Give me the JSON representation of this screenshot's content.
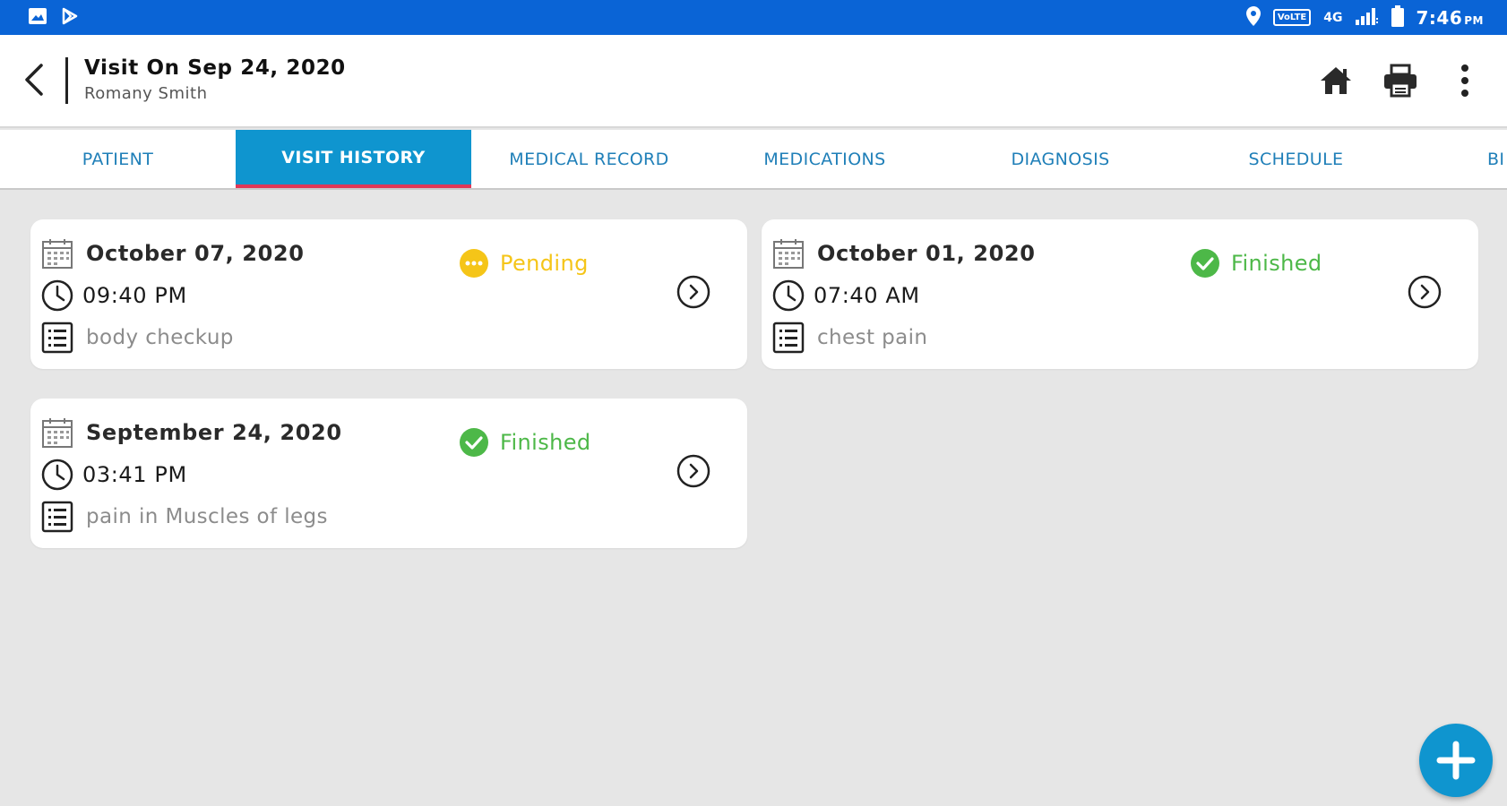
{
  "status_bar": {
    "time": "7:46",
    "time_suffix": "PM",
    "volte": "VoLTE",
    "network": "4G",
    "icons": [
      "image-icon",
      "play-store-icon",
      "location-icon",
      "signal-icon",
      "battery-icon"
    ]
  },
  "app_bar": {
    "title": "Visit On Sep 24, 2020",
    "subtitle": "Romany Smith",
    "actions": [
      "home-icon",
      "print-icon",
      "more-vert-icon"
    ]
  },
  "tabs": [
    {
      "label": "PATIENT",
      "active": false
    },
    {
      "label": "VISIT HISTORY",
      "active": true
    },
    {
      "label": "MEDICAL RECORD",
      "active": false
    },
    {
      "label": "MEDICATIONS",
      "active": false
    },
    {
      "label": "DIAGNOSIS",
      "active": false
    },
    {
      "label": "SCHEDULE",
      "active": false
    },
    {
      "label": "BI",
      "active": false
    }
  ],
  "visits": [
    {
      "date": "October 07, 2020",
      "time": "09:40 PM",
      "reason": "body checkup",
      "status": "Pending",
      "status_color": "#f5c518"
    },
    {
      "date": "October 01, 2020",
      "time": "07:40 AM",
      "reason": "chest pain",
      "status": "Finished",
      "status_color": "#4db848"
    },
    {
      "date": "September 24, 2020",
      "time": "03:41 PM",
      "reason": "pain in Muscles of legs",
      "status": "Finished",
      "status_color": "#4db848"
    }
  ],
  "colors": {
    "status_bar": "#0a64d6",
    "accent": "#0f95cf",
    "tab_indicator": "#e03757",
    "pending": "#f5c518",
    "finished": "#4db848"
  },
  "fab": {
    "icon": "add-icon"
  }
}
